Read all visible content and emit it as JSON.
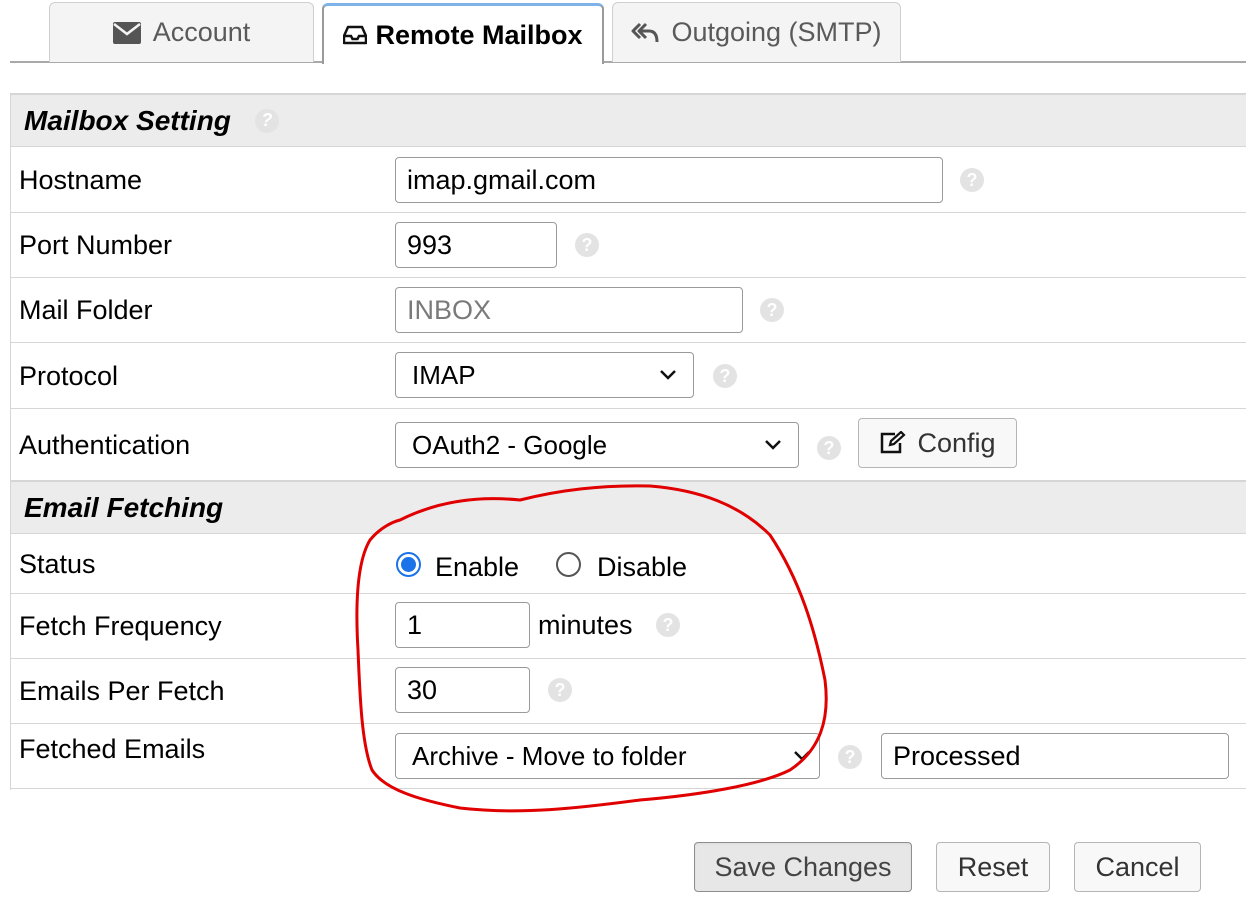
{
  "tabs": [
    {
      "label": "Account",
      "icon": "envelope-icon",
      "active": false
    },
    {
      "label": "Remote Mailbox",
      "icon": "inbox-icon",
      "active": true
    },
    {
      "label": "Outgoing (SMTP)",
      "icon": "reply-all-icon",
      "active": false
    }
  ],
  "mailbox_section": {
    "title": "Mailbox Setting",
    "hostname": {
      "label": "Hostname",
      "value": "imap.gmail.com"
    },
    "port": {
      "label": "Port Number",
      "value": "993"
    },
    "folder": {
      "label": "Mail Folder",
      "placeholder": "INBOX"
    },
    "protocol": {
      "label": "Protocol",
      "selected": "IMAP"
    },
    "auth": {
      "label": "Authentication",
      "selected": "OAuth2 - Google",
      "config_label": "Config"
    }
  },
  "fetching_section": {
    "title": "Email Fetching",
    "status": {
      "label": "Status",
      "enable_label": "Enable",
      "disable_label": "Disable",
      "selected": "Enable"
    },
    "frequency": {
      "label": "Fetch Frequency",
      "value": "1",
      "unit": "minutes"
    },
    "per_fetch": {
      "label": "Emails Per Fetch",
      "value": "30"
    },
    "fetched": {
      "label": "Fetched Emails",
      "selected": "Archive - Move to folder",
      "folder_value": "Processed"
    }
  },
  "buttons": {
    "save": "Save Changes",
    "reset": "Reset",
    "cancel": "Cancel"
  },
  "help_glyph": "?",
  "colors": {
    "annotation": "#e00000",
    "radio_accent": "#1a73e8",
    "active_tab_border": "#7fb2e6"
  }
}
